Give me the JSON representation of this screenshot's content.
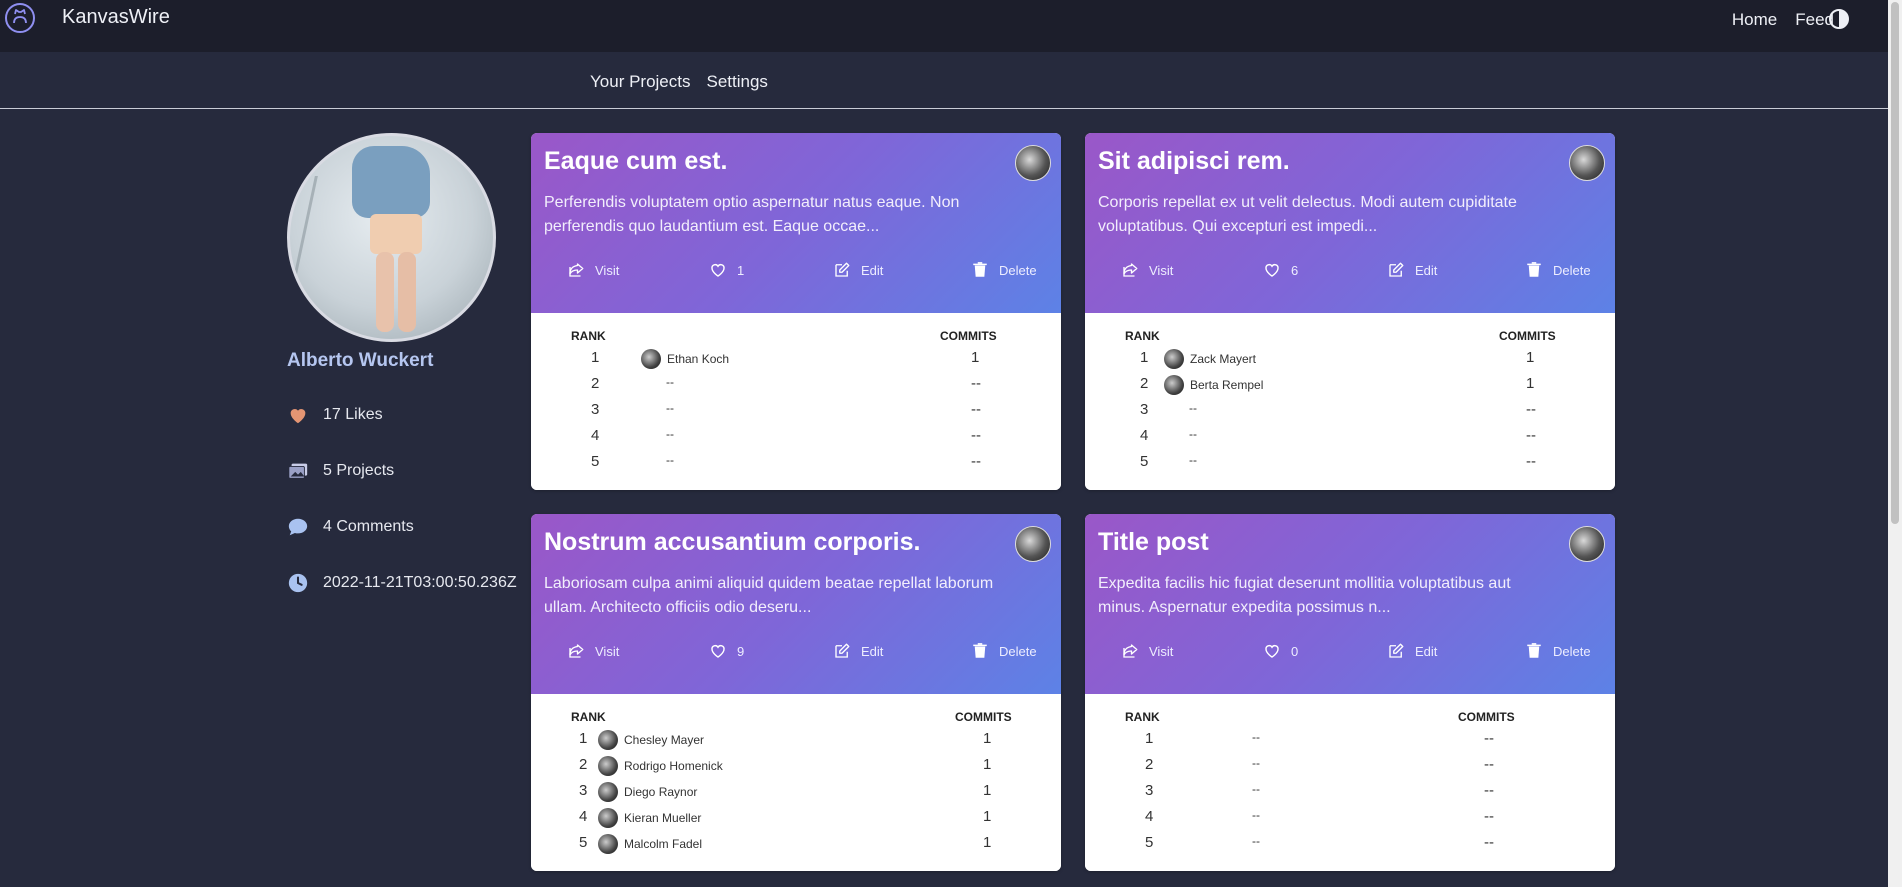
{
  "app": {
    "brand": "KanvasWire"
  },
  "topnav": {
    "home": "Home",
    "feed": "Feed"
  },
  "subnav": {
    "projects": "Your Projects",
    "settings": "Settings"
  },
  "profile": {
    "name": "Alberto Wuckert",
    "likes": "17 Likes",
    "projects": "5 Projects",
    "comments": "4 Comments",
    "joined": "2022-11-21T03:00:50.236Z"
  },
  "labels": {
    "rank": "RANK",
    "commits": "COMMITS",
    "visit": "Visit",
    "edit": "Edit",
    "delete": "Delete"
  },
  "cards": [
    {
      "title": "Eaque cum est.",
      "desc": "Perferendis voluptatem optio aspernatur natus eaque. Non perferendis quo laudantium est. Eaque occae...",
      "likes": "1",
      "rows": [
        {
          "rank": "1",
          "user": "Ethan Koch",
          "commits": "1"
        },
        {
          "rank": "2",
          "user": "--",
          "commits": "--"
        },
        {
          "rank": "3",
          "user": "--",
          "commits": "--"
        },
        {
          "rank": "4",
          "user": "--",
          "commits": "--"
        },
        {
          "rank": "5",
          "user": "--",
          "commits": "--"
        }
      ]
    },
    {
      "title": "Sit adipisci rem.",
      "desc": "Corporis repellat ex ut velit delectus. Modi autem cupiditate voluptatibus. Qui excepturi est impedi...",
      "likes": "6",
      "rows": [
        {
          "rank": "1",
          "user": "Zack Mayert",
          "commits": "1"
        },
        {
          "rank": "2",
          "user": "Berta Rempel",
          "commits": "1"
        },
        {
          "rank": "3",
          "user": "--",
          "commits": "--"
        },
        {
          "rank": "4",
          "user": "--",
          "commits": "--"
        },
        {
          "rank": "5",
          "user": "--",
          "commits": "--"
        }
      ]
    },
    {
      "title": "Nostrum accusantium corporis.",
      "desc": "Laboriosam culpa animi aliquid quidem beatae repellat laborum ullam. Architecto officiis odio deseru...",
      "likes": "9",
      "rows": [
        {
          "rank": "1",
          "user": "Chesley Mayer",
          "commits": "1"
        },
        {
          "rank": "2",
          "user": "Rodrigo Homenick",
          "commits": "1"
        },
        {
          "rank": "3",
          "user": "Diego Raynor",
          "commits": "1"
        },
        {
          "rank": "4",
          "user": "Kieran Mueller",
          "commits": "1"
        },
        {
          "rank": "5",
          "user": "Malcolm Fadel",
          "commits": "1"
        }
      ]
    },
    {
      "title": "Title post",
      "desc": "Expedita facilis hic fugiat deserunt mollitia voluptatibus aut minus. Aspernatur expedita possimus n...",
      "likes": "0",
      "rows": [
        {
          "rank": "1",
          "user": "--",
          "commits": "--"
        },
        {
          "rank": "2",
          "user": "--",
          "commits": "--"
        },
        {
          "rank": "3",
          "user": "--",
          "commits": "--"
        },
        {
          "rank": "4",
          "user": "--",
          "commits": "--"
        },
        {
          "rank": "5",
          "user": "--",
          "commits": "--"
        }
      ]
    }
  ]
}
